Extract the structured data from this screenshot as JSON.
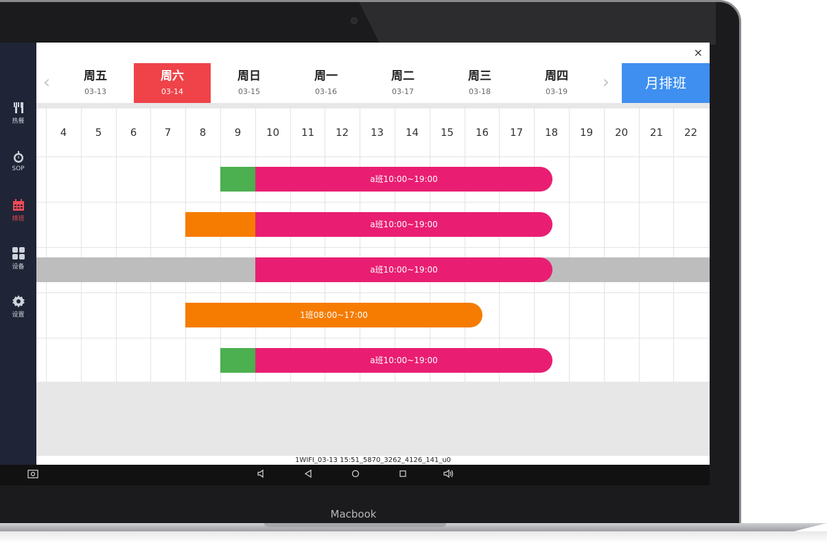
{
  "laptop": {
    "brand": "Macbook"
  },
  "sidebar": {
    "items": [
      {
        "icon": "fork-knife-icon",
        "label": "热餐",
        "active": false
      },
      {
        "icon": "stopwatch-icon",
        "label": "SOP",
        "active": false
      },
      {
        "icon": "calendar-icon",
        "label": "排班",
        "active": true
      },
      {
        "icon": "grid-icon",
        "label": "设备",
        "active": false
      },
      {
        "icon": "gear-icon",
        "label": "设置",
        "active": false
      }
    ]
  },
  "header": {
    "close_label": "×"
  },
  "days": [
    {
      "name": "周五",
      "date": "03-13",
      "active": false
    },
    {
      "name": "周六",
      "date": "03-14",
      "active": true
    },
    {
      "name": "周日",
      "date": "03-15",
      "active": false
    },
    {
      "name": "周一",
      "date": "03-16",
      "active": false
    },
    {
      "name": "周二",
      "date": "03-17",
      "active": false
    },
    {
      "name": "周三",
      "date": "03-18",
      "active": false
    },
    {
      "name": "周四",
      "date": "03-19",
      "active": false
    }
  ],
  "nav": {
    "prev": "‹",
    "next": "›",
    "month_button": "月排班"
  },
  "hours": [
    "4",
    "5",
    "6",
    "7",
    "8",
    "9",
    "10",
    "11",
    "12",
    "13",
    "14",
    "15",
    "16",
    "17",
    "18",
    "19",
    "20",
    "21",
    "22"
  ],
  "shifts": [
    {
      "pre_color": "#4caf50",
      "pre_start": 9,
      "start": 10,
      "end": 19,
      "label": "a班10:00~19:00",
      "color": "#e91e72",
      "highlight": false
    },
    {
      "pre_color": "#f57c00",
      "pre_start": 8,
      "start": 10,
      "end": 19,
      "label": "a班10:00~19:00",
      "color": "#e91e72",
      "highlight": false
    },
    {
      "pre_color": null,
      "pre_start": null,
      "start": 10,
      "end": 19,
      "label": "a班10:00~19:00",
      "color": "#e91e72",
      "highlight": true
    },
    {
      "pre_color": null,
      "pre_start": null,
      "start": 8,
      "end": 17,
      "label": "1班08:00~17:00",
      "color": "#f57c00",
      "highlight": false
    },
    {
      "pre_color": "#4caf50",
      "pre_start": 9,
      "start": 10,
      "end": 19,
      "label": "a班10:00~19:00",
      "color": "#e91e72",
      "highlight": false
    }
  ],
  "footer": {
    "device_id": "1WIFI_03-13 15:51_5870_3262_4126_141_u0"
  },
  "android_nav": {
    "screenshot_icon": "screenshot-icon",
    "volume_down_icon": "volume-down-icon",
    "back_icon": "back-icon",
    "home_icon": "home-icon",
    "recents_icon": "recents-icon",
    "volume_up_icon": "volume-up-icon"
  },
  "colors": {
    "accent_red": "#ef4349",
    "accent_blue": "#3e8ff0",
    "shift_pink": "#e91e72",
    "shift_orange": "#f57c00",
    "shift_green": "#4caf50"
  }
}
